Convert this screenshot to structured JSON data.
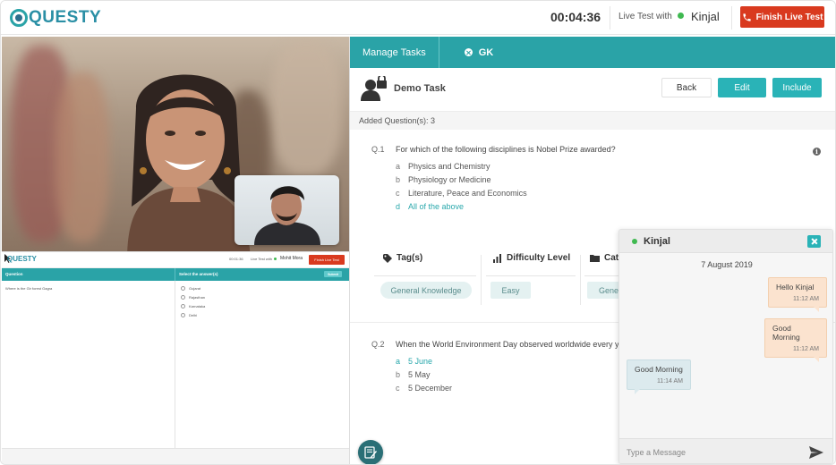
{
  "header": {
    "logo_text": "QUESTY",
    "timer": "00:04:36",
    "live_with_label": "Live Test with",
    "peer_name": "Kinjal",
    "finish_label": "Finish Live Test"
  },
  "shared_screen": {
    "logo_text": "QUESTY",
    "timer": "00:01:36",
    "live_with_label": "Live Test with",
    "peer_name": "Mohit Mora",
    "finish_label": "Finish Live Test",
    "col_question": "Question",
    "col_answer": "Select the answer(s)",
    "submit_label": "Submit",
    "question_text": "Where is the Gir forest Gagra",
    "options": [
      "Gujarat",
      "Rajasthan",
      "Karnataka",
      "Delhi"
    ]
  },
  "tabs": {
    "manage_tasks": "Manage Tasks",
    "gk": "GK"
  },
  "task": {
    "title": "Demo Task",
    "back_label": "Back",
    "edit_label": "Edit",
    "include_label": "Include"
  },
  "added_questions": "Added Question(s): 3",
  "questions": [
    {
      "number": "Q.1",
      "text": "For which of the following disciplines is Nobel Prize awarded?",
      "options": [
        {
          "letter": "a",
          "text": "Physics and Chemistry"
        },
        {
          "letter": "b",
          "text": "Physiology or Medicine"
        },
        {
          "letter": "c",
          "text": "Literature, Peace and Economics"
        },
        {
          "letter": "d",
          "text": "All of the above"
        }
      ],
      "meta": {
        "tags_label": "Tag(s)",
        "tag_value": "General Knowledge",
        "difficulty_label": "Difficulty Level",
        "difficulty_value": "Easy",
        "category_label": "Catal",
        "category_value": "Gener"
      }
    },
    {
      "number": "Q.2",
      "text": "When the World Environment Day observed worldwide every year",
      "options": [
        {
          "letter": "a",
          "text": "5 June"
        },
        {
          "letter": "b",
          "text": "5 May"
        },
        {
          "letter": "c",
          "text": "5 December"
        }
      ]
    }
  ],
  "chat": {
    "name": "Kinjal",
    "date": "7 August 2019",
    "messages": [
      {
        "text": "Hello Kinjal",
        "time": "11:12 AM"
      },
      {
        "text": "Good Morning",
        "time": "11:12 AM"
      },
      {
        "text": "Good Morning",
        "time": "11:14 AM"
      }
    ],
    "input_placeholder": "Type a Message"
  },
  "colors": {
    "brand_teal": "#2aa3a7",
    "button_teal": "#2ab3b7",
    "finish_red": "#d93a1f",
    "online_green": "#3fb950"
  }
}
